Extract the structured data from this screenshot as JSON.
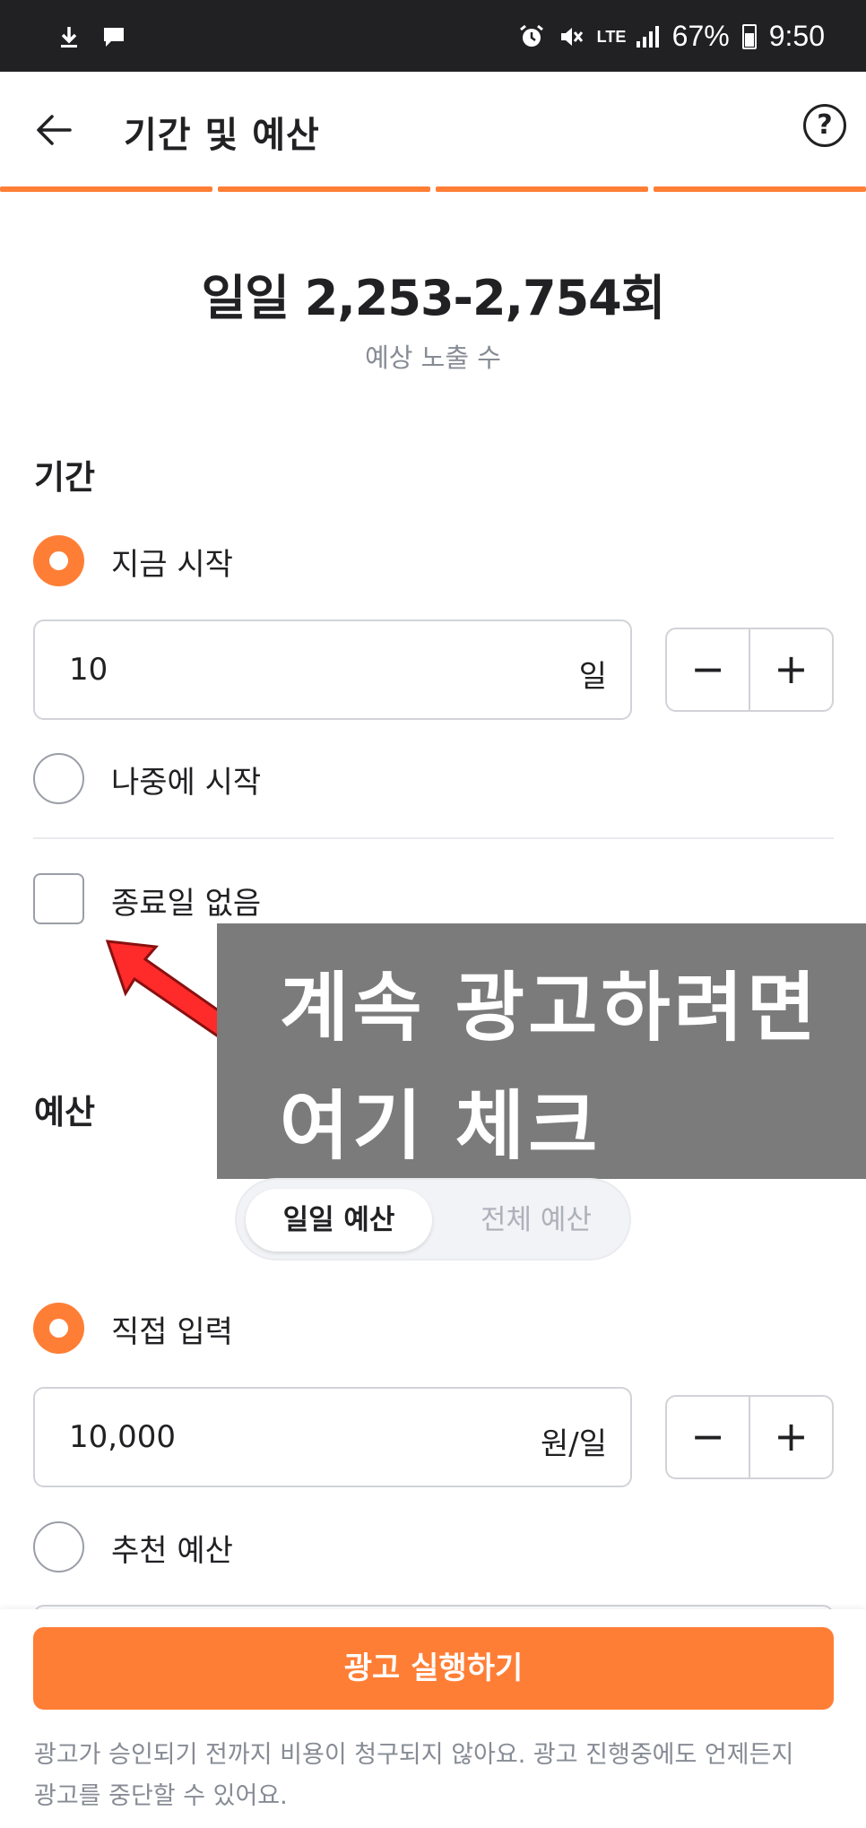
{
  "status_bar": {
    "battery": "67%",
    "time": "9:50",
    "network": "LTE"
  },
  "header": {
    "title": "기간 및 예산",
    "help": "?"
  },
  "estimate": {
    "value": "일일 2,253-2,754회",
    "label": "예상 노출 수"
  },
  "period": {
    "title": "기간",
    "start_now": "지금 시작",
    "duration_value": "10",
    "duration_unit": "일",
    "start_later": "나중에 시작",
    "no_end_date": "종료일 없음"
  },
  "annotation": {
    "line1": "계속 광고하려면",
    "line2": "여기 체크"
  },
  "budget": {
    "title": "예산",
    "tabs": [
      "일일 예산",
      "전체 예산"
    ],
    "manual": "직접 입력",
    "amount_value": "10,000",
    "amount_unit": "원/일",
    "recommended": "추천 예산"
  },
  "stepper": {
    "minus": "−",
    "plus": "+"
  },
  "footer": {
    "cta": "광고 실행하기",
    "notice_line1": "광고가 승인되기 전까지 비용이 청구되지 않아요. 광고 진행중에도 언제든지",
    "notice_line2": "광고를 중단할 수 있어요."
  },
  "colors": {
    "accent": "#ff7e36",
    "text": "#212124",
    "muted": "#868b94"
  }
}
